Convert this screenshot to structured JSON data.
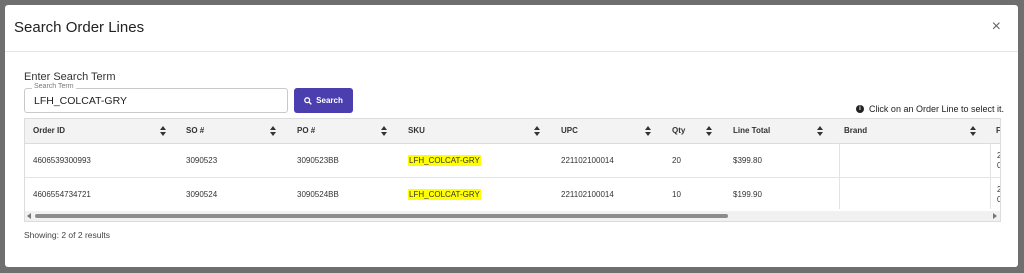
{
  "modal": {
    "title": "Search Order Lines",
    "close_glyph": "×"
  },
  "search": {
    "section_label": "Enter Search Term",
    "field_label": "Search Term",
    "value": "LFH_COLCAT-GRY",
    "button_label": "Search",
    "button_color": "#4b3fb0"
  },
  "hint": {
    "text": "Click on an Order Line to select it.",
    "icon": "info-icon"
  },
  "table": {
    "columns": [
      "Order ID",
      "SO #",
      "PO #",
      "SKU",
      "UPC",
      "Qty",
      "Line Total",
      "Brand",
      "F"
    ],
    "rows": [
      {
        "order_id": "4606539300993",
        "so": "3090523",
        "po": "3090523BB",
        "sku": "LFH_COLCAT-GRY",
        "upc": "221102100014",
        "qty": "20",
        "line_total": "$399.80",
        "brand": "",
        "f1": "2",
        "f2": "0"
      },
      {
        "order_id": "4606554734721",
        "so": "3090524",
        "po": "3090524BB",
        "sku": "LFH_COLCAT-GRY",
        "upc": "221102100014",
        "qty": "10",
        "line_total": "$199.90",
        "brand": "",
        "f1": "2",
        "f2": "0"
      }
    ],
    "highlight_color": "#ffff00"
  },
  "footer": {
    "showing": "Showing: 2 of 2 results"
  }
}
